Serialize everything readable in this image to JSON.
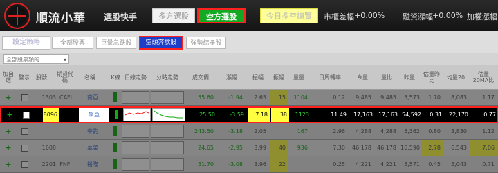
{
  "app": {
    "title": "順流小華",
    "subtitle": "選股快手"
  },
  "top_buttons": {
    "long": "多方選股",
    "short": "空方選股",
    "today": "今日多空總覽"
  },
  "market": {
    "label1": "市櫃差幅",
    "value1": "+0.00%",
    "label2": "融資漲幅",
    "value2": "+0.00%",
    "label3": "加權漲幅"
  },
  "strategy_button": "設定策略",
  "tabs": [
    "全部股票",
    "巨量急跌股",
    "空頭奔放股",
    "強勢結多股"
  ],
  "active_tab": 2,
  "filter_select": "全部股票類的",
  "headers": [
    "加自選",
    "警示",
    "股號",
    "期貨代碼",
    "名稱",
    "K線",
    "日線走勢",
    "分時走勢",
    "成交價",
    "漲幅",
    "振幅",
    "振幅",
    "量量",
    "日周轉率",
    "今量",
    "量比",
    "昨量",
    "估量昨比",
    "均量20",
    "估量20MA比"
  ],
  "rows": [
    {
      "add": "+",
      "code": "1303",
      "fut": "CAFI",
      "name": "南亞",
      "price": "55.60",
      "chg": "-1.94",
      "amp": "2.65",
      "amp2": "15",
      "vol": "1104",
      "turn": "0.12",
      "today": "9,485",
      "ratio": "9,485",
      "yvol": "5,573",
      "est": "1.70",
      "avg": "8,083",
      "ma": "1.17"
    },
    {
      "add": "+",
      "code": "8096",
      "fut": "",
      "name": "擎亞",
      "price": "25.50",
      "chg": "-3.59",
      "amp": "7.18",
      "amp2": "38",
      "vol": "1123",
      "turn": "11.49",
      "today": "17,163",
      "ratio": "17,163",
      "yvol": "54,592",
      "est": "0.31",
      "avg": "22,170",
      "ma": "0.77"
    },
    {
      "add": "+",
      "code": "",
      "fut": "",
      "name": "中釣",
      "price": "243.50",
      "chg": "-3.18",
      "amp": "2.05",
      "amp2": "",
      "vol": "167",
      "turn": "2.96",
      "today": "4,288",
      "ratio": "4,288",
      "yvol": "5,362",
      "est": "0.80",
      "avg": "3,830",
      "ma": "1.12"
    },
    {
      "add": "+",
      "code": "1608",
      "fut": "",
      "name": "華榮",
      "price": "24.65",
      "chg": "-2.95",
      "amp": "3.99",
      "amp2": "40",
      "vol": "936",
      "turn": "7.30",
      "today": "46,178",
      "ratio": "46,178",
      "yvol": "16,590",
      "est": "2.78",
      "avg": "6,543",
      "ma": "7.06"
    },
    {
      "add": "+",
      "code": "2201",
      "fut": "FNFI",
      "name": "裕隆",
      "price": "51.70",
      "chg": "-3.08",
      "amp": "3.96",
      "amp2": "22",
      "vol": "",
      "turn": "0.25",
      "today": "4,221",
      "ratio": "4,221",
      "yvol": "5,571",
      "est": "0.45",
      "avg": "5,043",
      "ma": "0.71"
    }
  ],
  "colors": {
    "accent_red": "#ff2020",
    "green": "#11aa22",
    "highlight_yellow": "#ffff40",
    "tab_blue": "#1f3ec8"
  }
}
